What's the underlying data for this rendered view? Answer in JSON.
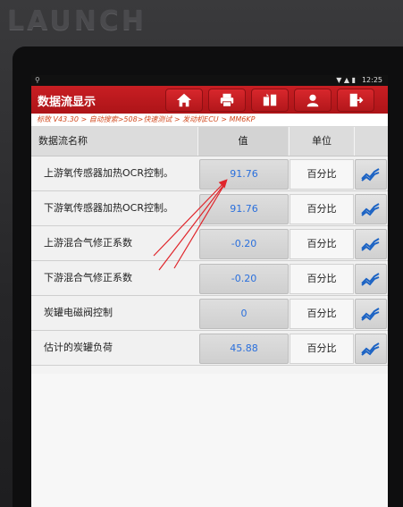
{
  "device": {
    "brand": "LAUNCH"
  },
  "status_bar": {
    "time": "12:25",
    "signal": "▼ ▲ ▮"
  },
  "title_bar": {
    "title": "数据流显示",
    "buttons": [
      {
        "icon": "home-icon"
      },
      {
        "icon": "printer-icon"
      },
      {
        "icon": "screenshot-icon"
      },
      {
        "icon": "user-icon"
      },
      {
        "icon": "exit-icon"
      }
    ]
  },
  "breadcrumb": "标致 V43.30 > 自动搜索>508>快速测试 > 发动机ECU > MM6KP",
  "table": {
    "headers": {
      "name": "数据流名称",
      "value": "值",
      "unit": "单位"
    },
    "rows": [
      {
        "name": "上游氧传感器加热OCR控制。",
        "value": "91.76",
        "unit": "百分比"
      },
      {
        "name": "下游氧传感器加热OCR控制。",
        "value": "91.76",
        "unit": "百分比"
      },
      {
        "name": "上游混合气修正系数",
        "value": "-0.20",
        "unit": "百分比"
      },
      {
        "name": "下游混合气修正系数",
        "value": "-0.20",
        "unit": "百分比"
      },
      {
        "name": "炭罐电磁阀控制",
        "value": "0",
        "unit": "百分比"
      },
      {
        "name": "估计的炭罐负荷",
        "value": "45.88",
        "unit": "百分比"
      }
    ]
  },
  "colors": {
    "title_bar": "#c81e23",
    "value_text": "#2a6fdc",
    "annotation_arrow": "#e0242a"
  }
}
